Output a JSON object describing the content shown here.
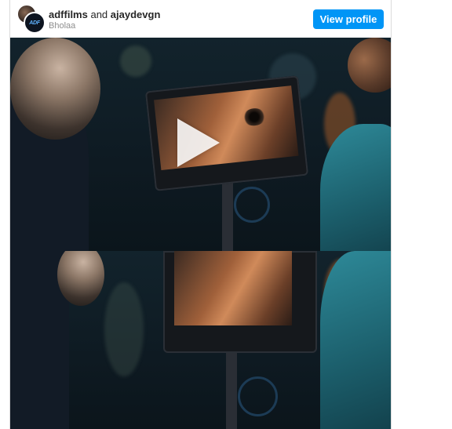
{
  "post": {
    "account_primary": "adffilms",
    "connector": "and",
    "account_secondary": "ajaydevgn",
    "location": "Bholaa",
    "avatar_logo_text": "ADF",
    "view_profile_label": "View profile"
  },
  "colors": {
    "button_bg": "#0095f6",
    "button_text": "#ffffff",
    "name_text": "#262626",
    "secondary_text": "#8e8e8e"
  },
  "media": {
    "type": "video",
    "play_icon": "play-icon"
  }
}
